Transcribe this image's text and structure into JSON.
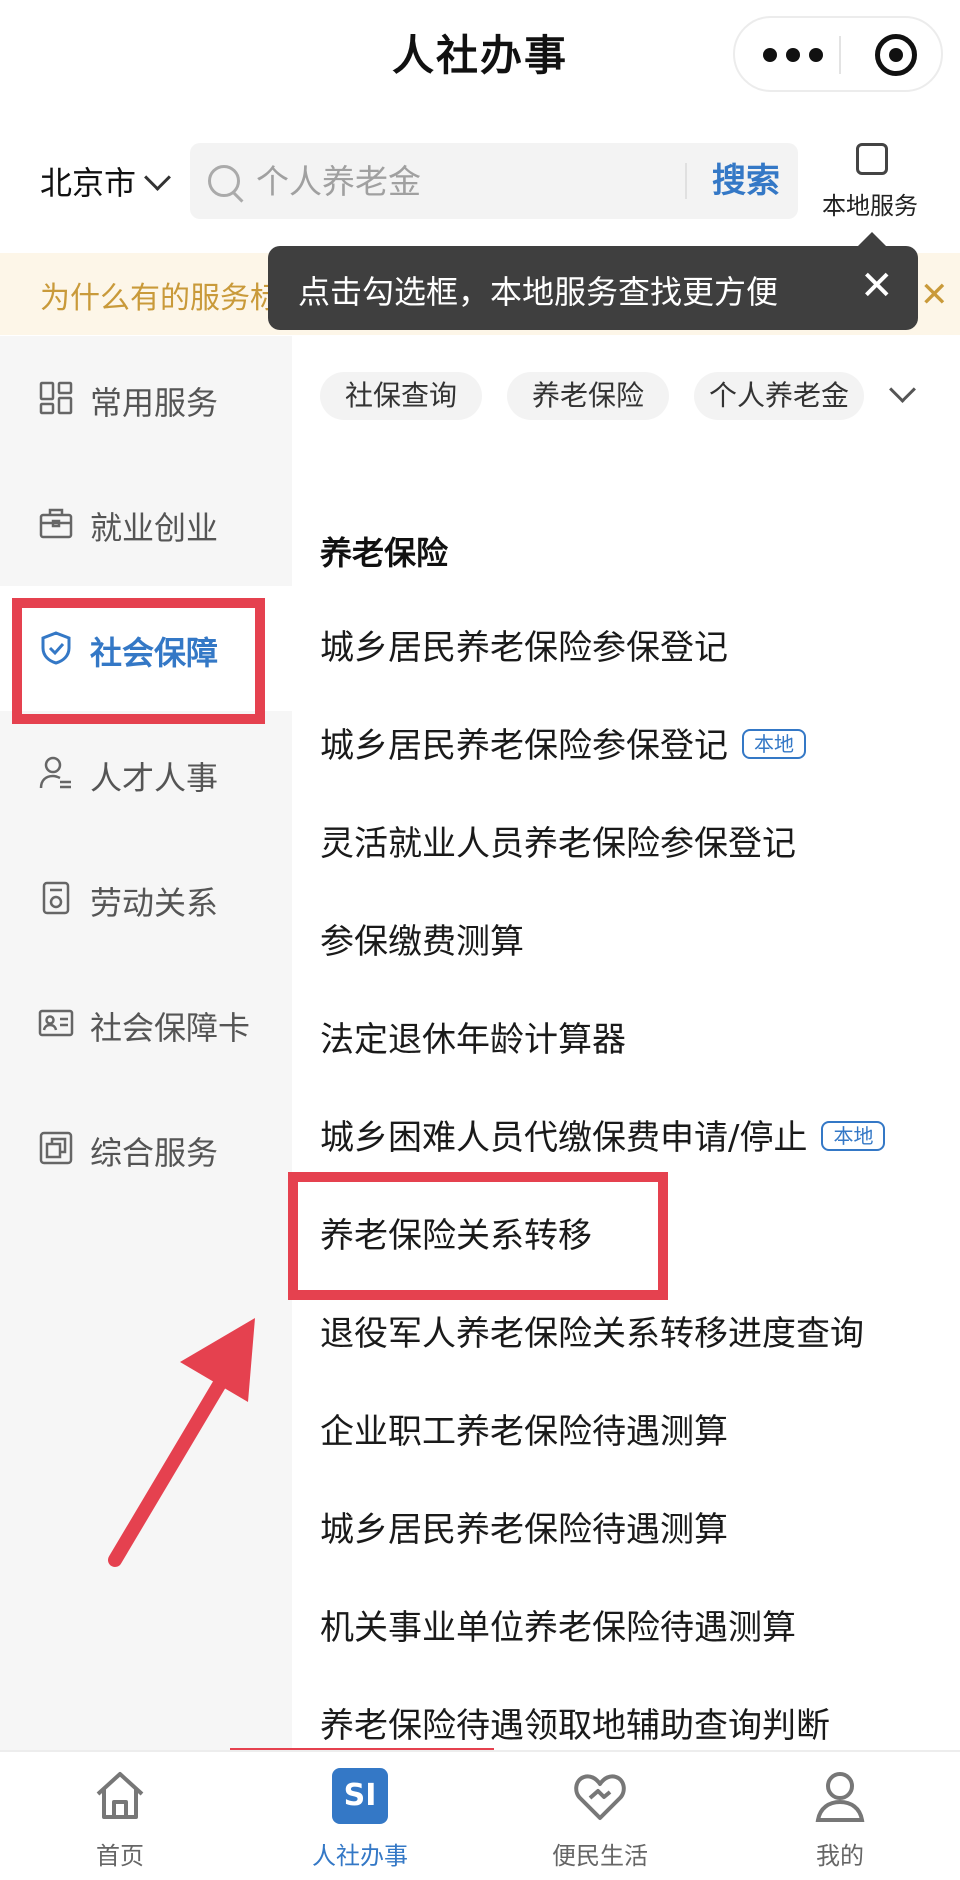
{
  "header": {
    "title": "人社办事"
  },
  "search": {
    "city": "北京市",
    "placeholder": "个人养老金",
    "button": "搜索",
    "local_service_label": "本地服务"
  },
  "notice": {
    "text": "为什么有的服务标志了“本地”？查看详情",
    "tooltip": "点击勾选框，本地服务查找更方便"
  },
  "sidebar": {
    "items": [
      {
        "label": "常用服务",
        "icon": "grid-icon"
      },
      {
        "label": "就业创业",
        "icon": "briefcase-icon"
      },
      {
        "label": "社会保障",
        "icon": "shield-check-icon",
        "active": true
      },
      {
        "label": "人才人事",
        "icon": "person-list-icon"
      },
      {
        "label": "劳动关系",
        "icon": "document-stamp-icon"
      },
      {
        "label": "社会保障卡",
        "icon": "id-card-icon"
      },
      {
        "label": "综合服务",
        "icon": "layers-icon"
      }
    ]
  },
  "tags": [
    "社保查询",
    "养老保险",
    "个人养老金"
  ],
  "section": {
    "title": "养老保险",
    "items": [
      {
        "label": "城乡居民养老保险参保登记",
        "badge": ""
      },
      {
        "label": "城乡居民养老保险参保登记",
        "badge": "本地"
      },
      {
        "label": "灵活就业人员养老保险参保登记",
        "badge": ""
      },
      {
        "label": "参保缴费测算",
        "badge": ""
      },
      {
        "label": "法定退休年龄计算器",
        "badge": ""
      },
      {
        "label": "城乡困难人员代缴保费申请/停止",
        "badge": "本地"
      },
      {
        "label": "养老保险关系转移",
        "badge": ""
      },
      {
        "label": "退役军人养老保险关系转移进度查询",
        "badge": ""
      },
      {
        "label": "企业职工养老保险待遇测算",
        "badge": ""
      },
      {
        "label": "城乡居民养老保险待遇测算",
        "badge": ""
      },
      {
        "label": "机关事业单位养老保险待遇测算",
        "badge": ""
      },
      {
        "label": "养老保险待遇领取地辅助查询判断",
        "badge": ""
      }
    ]
  },
  "tabbar": {
    "items": [
      {
        "label": "首页",
        "icon": "home-icon"
      },
      {
        "label": "人社办事",
        "icon": "si-logo-icon",
        "active": true,
        "logo_text": "SI"
      },
      {
        "label": "便民生活",
        "icon": "heart-hands-icon"
      },
      {
        "label": "我的",
        "icon": "user-icon"
      }
    ]
  },
  "colors": {
    "accent": "#3478c6",
    "annotation": "#e5414f",
    "notice": "#c99a3a"
  }
}
